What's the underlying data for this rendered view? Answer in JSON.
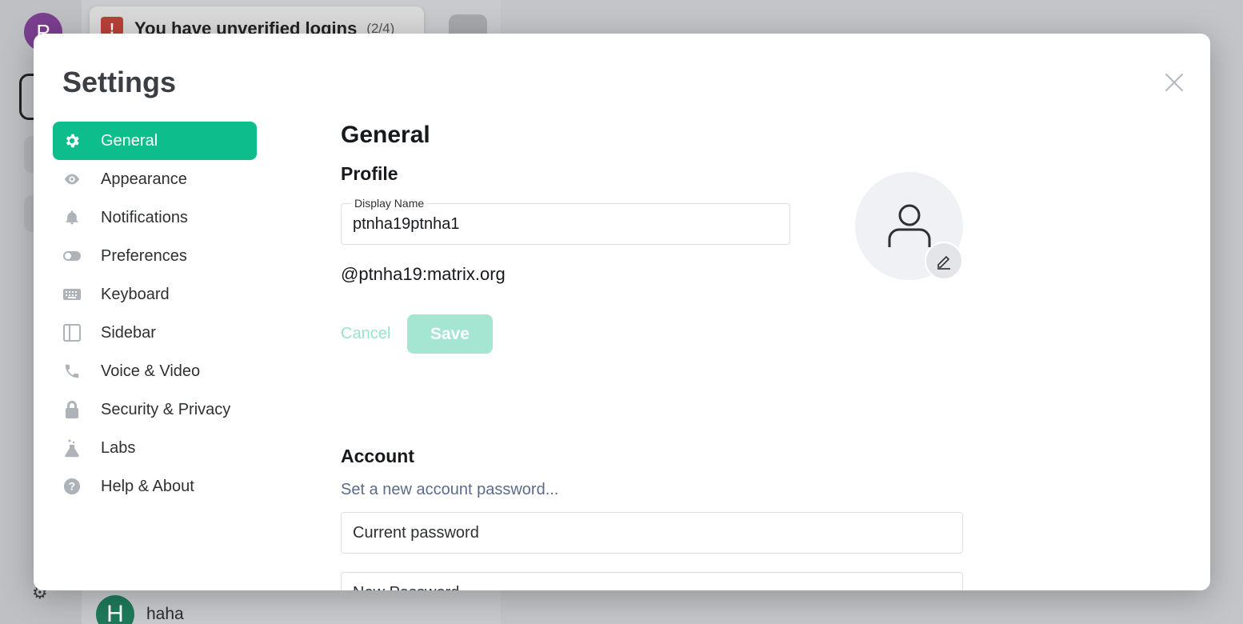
{
  "background": {
    "user_initial": "P",
    "toast_title": "You have unverified logins",
    "toast_count": "(2/4)",
    "room_initial": "H",
    "room_name": "haha"
  },
  "settings": {
    "title": "Settings",
    "nav": [
      {
        "label": "General",
        "icon": "gear-icon",
        "active": true
      },
      {
        "label": "Appearance",
        "icon": "eye-icon"
      },
      {
        "label": "Notifications",
        "icon": "bell-icon"
      },
      {
        "label": "Preferences",
        "icon": "toggle-icon"
      },
      {
        "label": "Keyboard",
        "icon": "keyboard-icon"
      },
      {
        "label": "Sidebar",
        "icon": "sidebar-icon"
      },
      {
        "label": "Voice & Video",
        "icon": "phone-icon"
      },
      {
        "label": "Security & Privacy",
        "icon": "lock-icon"
      },
      {
        "label": "Labs",
        "icon": "flask-icon"
      },
      {
        "label": "Help & About",
        "icon": "help-icon"
      }
    ]
  },
  "general": {
    "heading": "General",
    "profile_heading": "Profile",
    "display_name_label": "Display Name",
    "display_name_value": "ptnha19ptnha1",
    "matrix_id": "@ptnha19:matrix.org",
    "cancel_label": "Cancel",
    "save_label": "Save",
    "account_heading": "Account",
    "password_link": "Set a new account password...",
    "current_password_placeholder": "Current password",
    "new_password_placeholder": "New Password"
  },
  "colors": {
    "accent": "#0dbd8b",
    "save_disabled": "#a4e6d1",
    "link": "#5c6b8a"
  }
}
